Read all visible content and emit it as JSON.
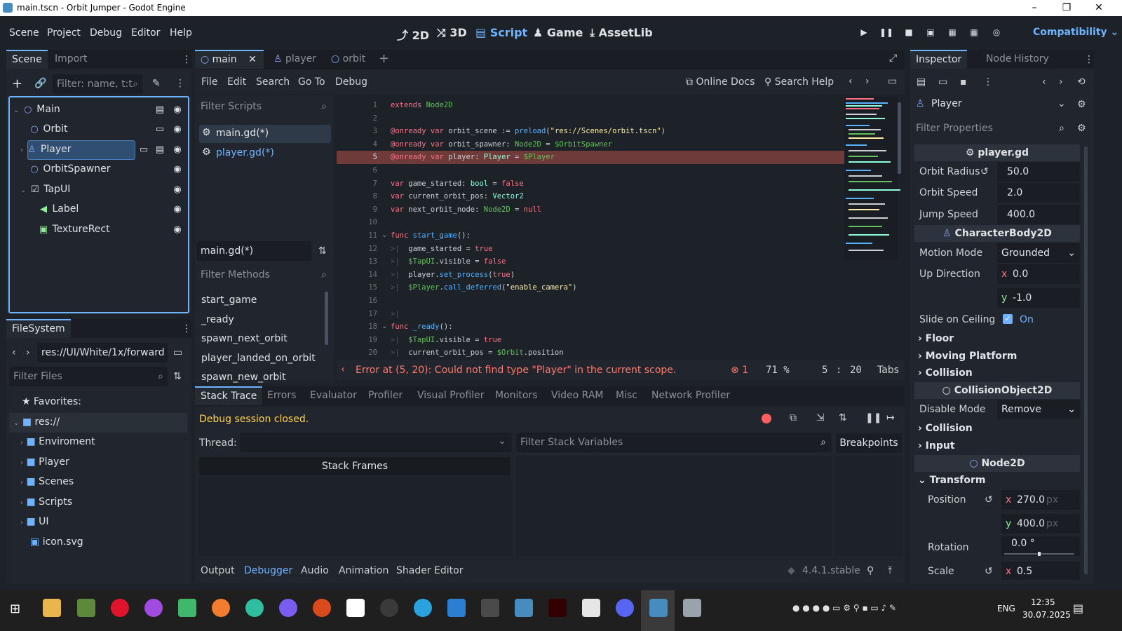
{
  "window": {
    "title": "main.tscn - Orbit Jumper - Godot Engine",
    "minimize": "–",
    "maximize": "❐",
    "close": "✕"
  },
  "menu": {
    "items": [
      "Scene",
      "Project",
      "Debug",
      "Editor",
      "Help"
    ]
  },
  "workspaces": [
    "2D",
    "3D",
    "Script",
    "Game",
    "AssetLib"
  ],
  "renderer": "Compatibility",
  "scene_dock": {
    "tabs": [
      "Scene",
      "Import"
    ],
    "filter_placeholder": "Filter: name, t:t",
    "tree": [
      {
        "label": "Main",
        "level": 0
      },
      {
        "label": "Orbit",
        "level": 1
      },
      {
        "label": "Player",
        "level": 1
      },
      {
        "label": "OrbitSpawner",
        "level": 1
      },
      {
        "label": "TapUI",
        "level": 1
      },
      {
        "label": "Label",
        "level": 2
      },
      {
        "label": "TextureRect",
        "level": 2
      }
    ]
  },
  "filesystem": {
    "title": "FileSystem",
    "path": "res://UI/White/1x/forward",
    "filter_placeholder": "Filter Files",
    "favorites": "Favorites:",
    "root": "res://",
    "folders": [
      "Enviroment",
      "Player",
      "Scenes",
      "Scripts",
      "UI"
    ],
    "files": [
      "icon.svg"
    ]
  },
  "scene_tabs": [
    "main",
    "player",
    "orbit"
  ],
  "script_menu": {
    "items": [
      "File",
      "Edit",
      "Search",
      "Go To",
      "Debug"
    ],
    "online_docs": "Online Docs",
    "search_help": "Search Help"
  },
  "scripts": {
    "filter_placeholder": "Filter Scripts",
    "items": [
      "main.gd(*)",
      "player.gd(*)"
    ],
    "current": "main.gd(*)"
  },
  "methods": {
    "filter_placeholder": "Filter Methods",
    "items": [
      "start_game",
      "_ready",
      "spawn_next_orbit",
      "player_landed_on_orbit",
      "spawn_new_orbit"
    ]
  },
  "code": {
    "lines": [
      "1",
      "2",
      "3",
      "4",
      "5",
      "6",
      "7",
      "8",
      "9",
      "10",
      "11",
      "12",
      "13",
      "14",
      "15",
      "16",
      "17",
      "18",
      "19",
      "20"
    ],
    "status": {
      "error": "Error at (5, 20): Could not find type \"Player\" in the current scope.",
      "error_count": "1",
      "zoom": "71 %",
      "line": "5",
      "col": "20",
      "indent": "Tabs"
    }
  },
  "debugger": {
    "tabs": [
      "Stack Trace",
      "Errors",
      "Evaluator",
      "Profiler",
      "Visual Profiler",
      "Monitors",
      "Video RAM",
      "Misc",
      "Network Profiler"
    ],
    "message": "Debug session closed.",
    "thread_label": "Thread:",
    "filter_vars": "Filter Stack Variables",
    "breakpoints": "Breakpoints",
    "stack_frames": "Stack Frames"
  },
  "bottom_tabs": [
    "Output",
    "Debugger",
    "Audio",
    "Animation",
    "Shader Editor"
  ],
  "version": "4.4.1.stable",
  "inspector": {
    "tabs": [
      "Inspector",
      "Node",
      "History"
    ],
    "object": "Player",
    "filter_placeholder": "Filter Properties",
    "script_section": "player.gd",
    "orbit_radius_label": "Orbit Radius",
    "orbit_radius": "50.0",
    "orbit_speed_label": "Orbit Speed",
    "orbit_speed": "2.0",
    "jump_speed_label": "Jump Speed",
    "jump_speed": "400.0",
    "body_section": "CharacterBody2D",
    "motion_mode_label": "Motion Mode",
    "motion_mode": "Grounded",
    "up_direction_label": "Up Direction",
    "up_x": "0.0",
    "up_y": "-1.0",
    "slide_label": "Slide on Ceiling",
    "slide_value": "On",
    "groups1": [
      "Floor",
      "Moving Platform",
      "Collision"
    ],
    "collision_section": "CollisionObject2D",
    "disable_mode_label": "Disable Mode",
    "disable_mode": "Remove",
    "groups2": [
      "Collision",
      "Input"
    ],
    "node2d_section": "Node2D",
    "transform": "Transform",
    "position_label": "Position",
    "pos_x": "270.0",
    "pos_y": "400.0",
    "unit": "px",
    "rotation_label": "Rotation",
    "rotation": "0.0 °",
    "scale_label": "Scale",
    "scale_x": "0.5"
  },
  "taskbar": {
    "lang": "ENG",
    "time": "12:35",
    "date": "30.07.2025"
  }
}
